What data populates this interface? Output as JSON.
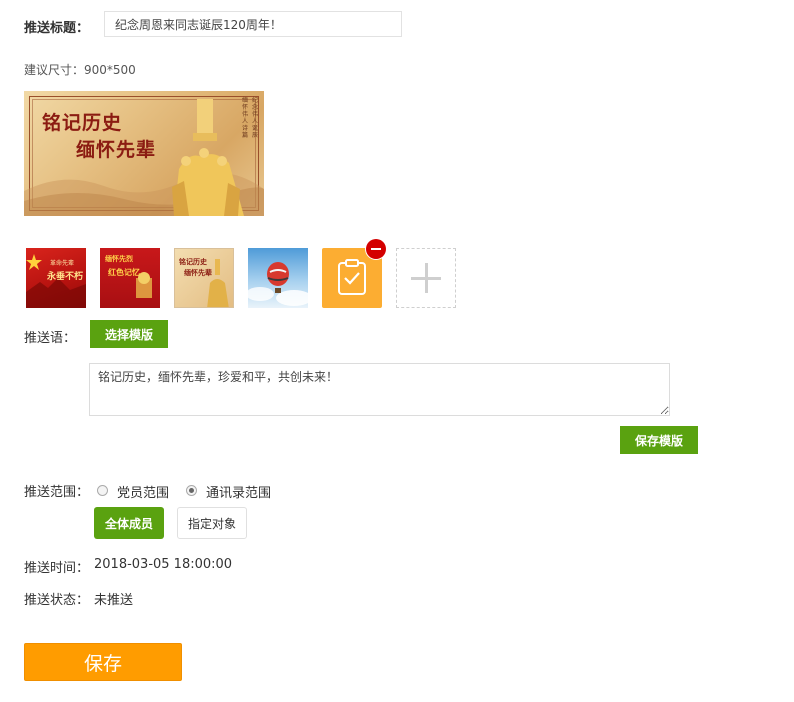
{
  "push_title": {
    "label": "推送标题：",
    "value": "纪念周恩来同志诞辰120周年！"
  },
  "image_section": {
    "size_hint": "建议尺寸：900*500",
    "banner": {
      "line1": "铭记历史",
      "line2": "缅怀先辈",
      "vertical_text_a": "缅怀伟人诗篇",
      "vertical_text_b": "纪念伟人诞辰"
    },
    "thumbnails": [
      {
        "name": "thumb-red-flag",
        "caption_top": "革命先辈",
        "caption_main": "永垂不朽"
      },
      {
        "name": "thumb-red-banner",
        "caption_top": "缅怀先烈",
        "caption_main": "红色记忆"
      },
      {
        "name": "thumb-monument",
        "caption_top": "铭记历史",
        "caption_main": "缅怀先辈"
      },
      {
        "name": "thumb-hot-air-balloon"
      },
      {
        "name": "thumb-clipboard",
        "icon": "clipboard-check-icon",
        "color": "#fcad32",
        "selected": true
      }
    ],
    "remove_badge_color": "#d40000"
  },
  "push_message": {
    "label": "推送语：",
    "choose_template_label": "选择模版",
    "message": "铭记历史，缅怀先辈，珍爱和平，共创未来！",
    "save_template_label": "保存模版"
  },
  "push_scope": {
    "label": "推送范围：",
    "options": [
      {
        "label": "党员范围",
        "checked": false
      },
      {
        "label": "通讯录范围",
        "checked": true
      }
    ],
    "all_members_label": "全体成员",
    "specify_target_label": "指定对象"
  },
  "push_time": {
    "label": "推送时间：",
    "value": "2018-03-05 18:00:00"
  },
  "push_status": {
    "label": "推送状态：",
    "value": "未推送"
  },
  "save_label": "保存",
  "colors": {
    "accent_green": "#5aa210",
    "save_orange": "#ff9c00"
  }
}
